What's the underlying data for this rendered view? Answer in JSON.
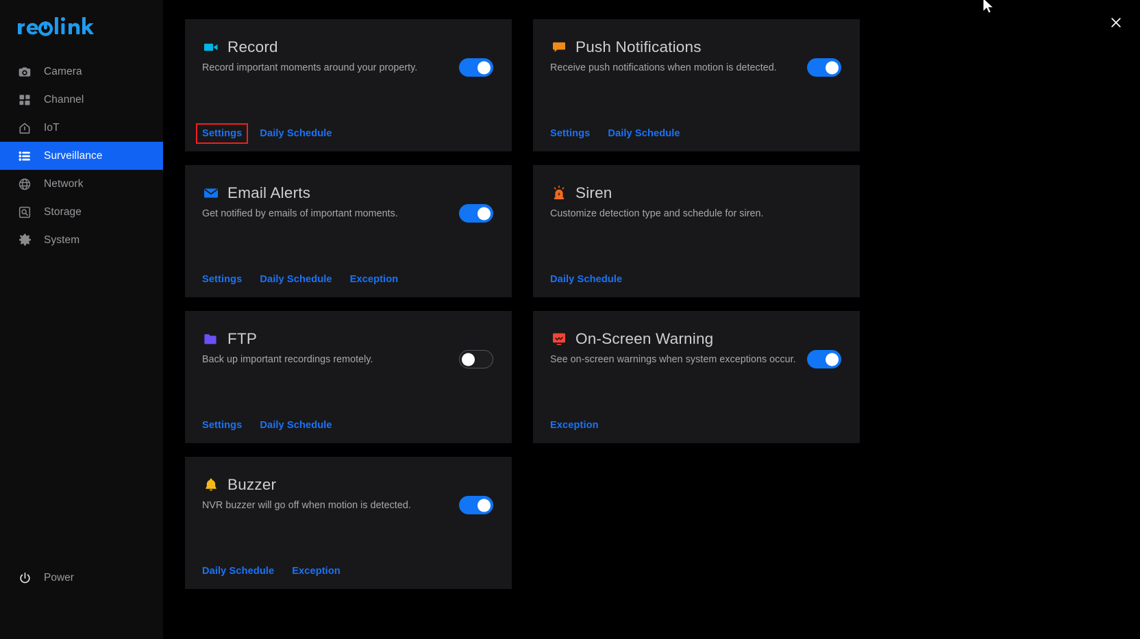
{
  "brand": {
    "name": "reolink",
    "color": "#1e9bf0"
  },
  "sidebar": {
    "items": [
      {
        "label": "Camera",
        "icon": "camera-icon",
        "active": false
      },
      {
        "label": "Channel",
        "icon": "grid-icon",
        "active": false
      },
      {
        "label": "IoT",
        "icon": "home-icon",
        "active": false
      },
      {
        "label": "Surveillance",
        "icon": "list-icon",
        "active": true
      },
      {
        "label": "Network",
        "icon": "globe-icon",
        "active": false
      },
      {
        "label": "Storage",
        "icon": "hard-drive-icon",
        "active": false
      },
      {
        "label": "System",
        "icon": "gear-icon",
        "active": false
      }
    ],
    "power": {
      "label": "Power",
      "icon": "power-icon"
    },
    "active_color": "#1163f3"
  },
  "header": {
    "close_icon": "close-icon"
  },
  "cards": {
    "record": {
      "title": "Record",
      "description": "Record important moments around your property.",
      "icon": "video-camera-icon",
      "icon_color": "#00b5e2",
      "toggle": "on",
      "links": [
        {
          "label": "Settings",
          "highlighted": true
        },
        {
          "label": "Daily Schedule",
          "highlighted": false
        }
      ]
    },
    "push_notifications": {
      "title": "Push Notifications",
      "description": "Receive push notifications when motion is detected.",
      "icon": "speech-bubble-icon",
      "icon_color": "#ef8a1b",
      "toggle": "on",
      "links": [
        {
          "label": "Settings",
          "highlighted": false
        },
        {
          "label": "Daily Schedule",
          "highlighted": false
        }
      ]
    },
    "email_alerts": {
      "title": "Email Alerts",
      "description": "Get notified by emails of important moments.",
      "icon": "envelope-icon",
      "icon_color": "#1175f5",
      "toggle": "on",
      "links": [
        {
          "label": "Settings",
          "highlighted": false
        },
        {
          "label": "Daily Schedule",
          "highlighted": false
        },
        {
          "label": "Exception",
          "highlighted": false
        }
      ]
    },
    "siren": {
      "title": "Siren",
      "description": "Customize detection type and schedule for siren.",
      "icon": "siren-icon",
      "icon_color": "#f26a21",
      "toggle": "none",
      "links": [
        {
          "label": "Daily Schedule",
          "highlighted": false
        }
      ]
    },
    "ftp": {
      "title": "FTP",
      "description": "Back up important recordings remotely.",
      "icon": "folder-icon",
      "icon_color": "#6c4ff6",
      "toggle": "off",
      "links": [
        {
          "label": "Settings",
          "highlighted": false
        },
        {
          "label": "Daily Schedule",
          "highlighted": false
        }
      ]
    },
    "on_screen_warning": {
      "title": "On-Screen Warning",
      "description": "See on-screen warnings when system exceptions occur.",
      "icon": "monitor-warning-icon",
      "icon_color": "#f0453a",
      "toggle": "on",
      "links": [
        {
          "label": "Exception",
          "highlighted": false
        }
      ]
    },
    "buzzer": {
      "title": "Buzzer",
      "description": "NVR buzzer will go off when motion is detected.",
      "icon": "bell-icon",
      "icon_color": "#f5b91c",
      "toggle": "on",
      "links": [
        {
          "label": "Daily Schedule",
          "highlighted": false
        },
        {
          "label": "Exception",
          "highlighted": false
        }
      ]
    }
  },
  "colors": {
    "accent_blue": "#1175f5",
    "link_blue": "#1a73f8",
    "card_bg": "#18181a",
    "sidebar_bg": "#0d0d0e",
    "page_bg": "#000000",
    "highlight_box": "#f02020"
  }
}
